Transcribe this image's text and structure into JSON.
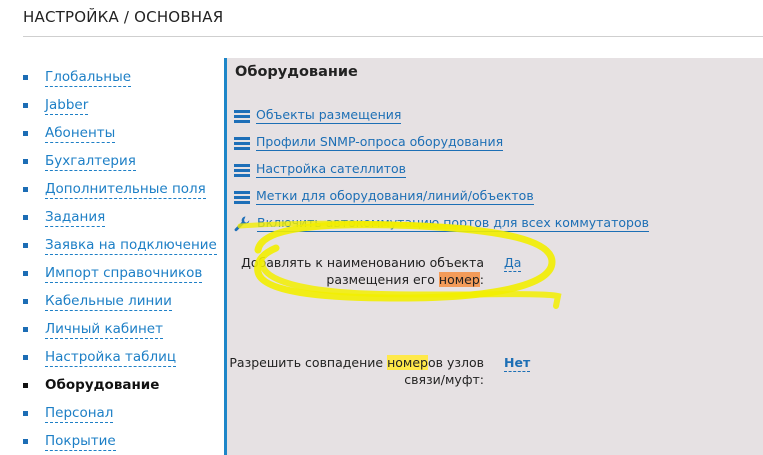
{
  "header": {
    "title": "НАСТРОЙКА / ОСНОВНАЯ"
  },
  "sidebar": {
    "items": [
      {
        "label": "Глобальные",
        "active": false
      },
      {
        "label": "Jabber",
        "active": false
      },
      {
        "label": "Абоненты",
        "active": false
      },
      {
        "label": "Бухгалтерия",
        "active": false
      },
      {
        "label": "Дополнительные поля",
        "active": false
      },
      {
        "label": "Задания",
        "active": false
      },
      {
        "label": "Заявка на подключение",
        "active": false
      },
      {
        "label": "Импорт справочников",
        "active": false
      },
      {
        "label": "Кабельные линии",
        "active": false
      },
      {
        "label": "Личный кабинет",
        "active": false
      },
      {
        "label": "Настройка таблиц",
        "active": false
      },
      {
        "label": "Оборудование",
        "active": true
      },
      {
        "label": "Персонал",
        "active": false
      },
      {
        "label": "Покрытие",
        "active": false
      }
    ]
  },
  "panel": {
    "title": "Оборудование",
    "links": [
      {
        "label": "Объекты размещения",
        "icon": "list-icon"
      },
      {
        "label": "Профили SNMP-опроса оборудования",
        "icon": "list-icon"
      },
      {
        "label": "Настройка сателлитов",
        "icon": "list-icon"
      },
      {
        "label": "Метки для оборудования/линий/объектов",
        "icon": "list-icon"
      }
    ],
    "action_link": {
      "label": "Включить автокоммутацию портов для всех коммутаторов",
      "icon": "wrench-icon"
    },
    "settings": [
      {
        "line1": "Добавлять к наименованию объекта",
        "line2_pre": "размещения его ",
        "line2_hl": "номер",
        "line2_post": ":",
        "value": "Да"
      },
      {
        "line1_pre": "Разрешить совпадение ",
        "line1_hl": "номер",
        "line1_post": "ов узлов",
        "line2": "связи/муфт:",
        "value": "Нет"
      }
    ]
  },
  "colors": {
    "accent": "#1e86c8",
    "link": "#1d7fc6",
    "panel_bg": "#e6e1e3",
    "highlight_orange": "#f39b59",
    "highlight_yellow": "#ffe94a",
    "annotation_marker": "#f2ee00"
  }
}
